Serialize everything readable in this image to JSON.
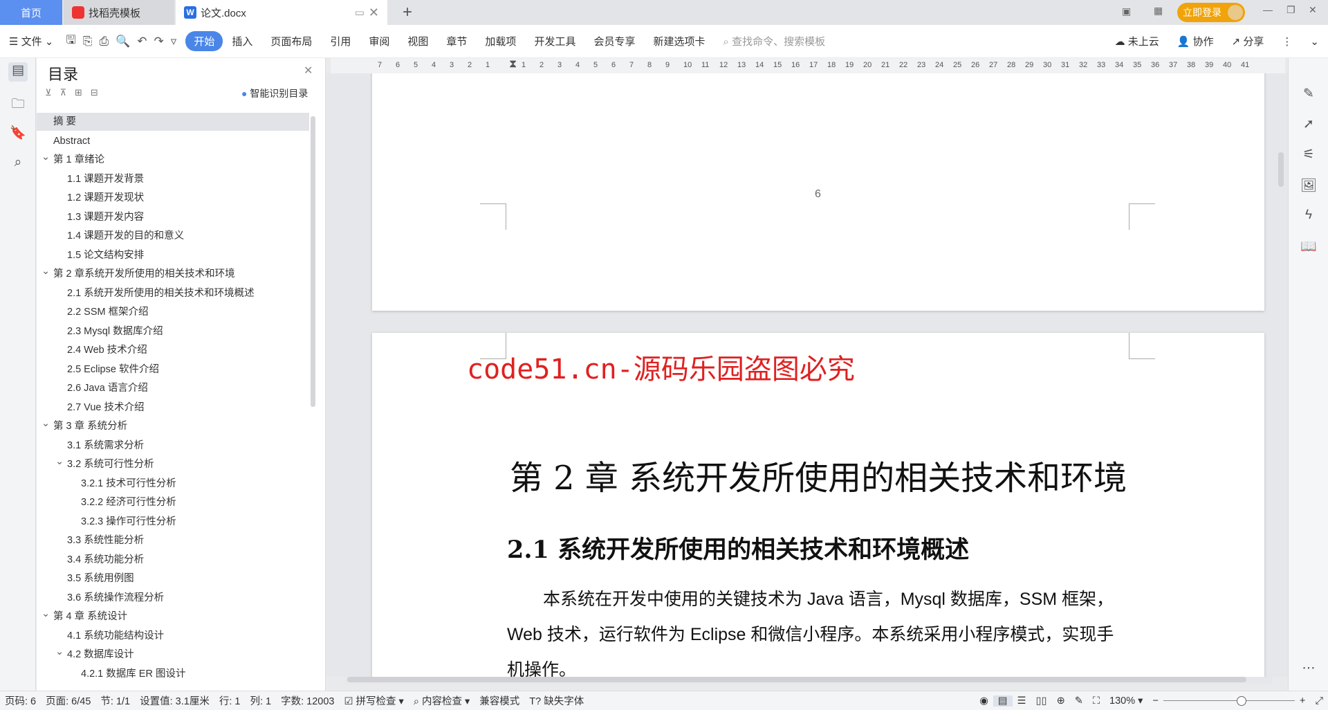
{
  "tabs": [
    {
      "label": "首页",
      "active": false
    },
    {
      "label": "找稻壳模板"
    },
    {
      "label": "论文.docx",
      "active": true
    }
  ],
  "titlebar": {
    "login": "立即登录",
    "new_tab": "+"
  },
  "toolbar": {
    "file": "文件",
    "menus": [
      "开始",
      "插入",
      "页面布局",
      "引用",
      "审阅",
      "视图",
      "章节",
      "加载项",
      "开发工具",
      "会员专享",
      "新建选项卡"
    ],
    "search_placeholder": "查找命令、搜索模板",
    "cloud": "未上云",
    "collab": "协作",
    "share": "分享"
  },
  "ruler": {
    "left": [
      "7",
      "6",
      "5",
      "4",
      "3",
      "2",
      "1"
    ],
    "right": [
      "1",
      "2",
      "3",
      "4",
      "5",
      "6",
      "7",
      "8",
      "9",
      "10",
      "11",
      "12",
      "13",
      "14",
      "15",
      "16",
      "17",
      "18",
      "19",
      "20",
      "21",
      "22",
      "23",
      "24",
      "25",
      "26",
      "27",
      "28",
      "29",
      "30",
      "31",
      "32",
      "33",
      "34",
      "35",
      "36",
      "37",
      "38",
      "39",
      "40",
      "41"
    ]
  },
  "outline": {
    "title": "目录",
    "smart": "智能识别目录",
    "items": [
      {
        "t": "摘  要",
        "l": 0,
        "sel": true
      },
      {
        "t": "Abstract",
        "l": 0
      },
      {
        "t": "第 1 章绪论",
        "l": 0,
        "c": true
      },
      {
        "t": "1.1 课题开发背景",
        "l": 1
      },
      {
        "t": "1.2 课题开发现状",
        "l": 1
      },
      {
        "t": "1.3 课题开发内容",
        "l": 1
      },
      {
        "t": "1.4 课题开发的目的和意义",
        "l": 1
      },
      {
        "t": "1.5 论文结构安排",
        "l": 1
      },
      {
        "t": "第 2 章系统开发所使用的相关技术和环境",
        "l": 0,
        "c": true
      },
      {
        "t": "2.1 系统开发所使用的相关技术和环境概述",
        "l": 1
      },
      {
        "t": "2.2 SSM 框架介绍",
        "l": 1
      },
      {
        "t": "2.3 Mysql 数据库介绍",
        "l": 1
      },
      {
        "t": "2.4 Web 技术介绍",
        "l": 1
      },
      {
        "t": "2.5 Eclipse 软件介绍",
        "l": 1
      },
      {
        "t": "2.6 Java 语言介绍",
        "l": 1
      },
      {
        "t": "2.7 Vue 技术介绍",
        "l": 1
      },
      {
        "t": "第 3 章  系统分析",
        "l": 0,
        "c": true
      },
      {
        "t": "3.1 系统需求分析",
        "l": 1
      },
      {
        "t": "3.2 系统可行性分析",
        "l": 1,
        "c": true
      },
      {
        "t": "3.2.1 技术可行性分析",
        "l": 2
      },
      {
        "t": "3.2.2 经济可行性分析",
        "l": 2
      },
      {
        "t": "3.2.3 操作可行性分析",
        "l": 2
      },
      {
        "t": "3.3 系统性能分析",
        "l": 1
      },
      {
        "t": "3.4  系统功能分析",
        "l": 1
      },
      {
        "t": "3.5 系统用例图",
        "l": 1
      },
      {
        "t": "3.6 系统操作流程分析",
        "l": 1
      },
      {
        "t": "第 4 章  系统设计",
        "l": 0,
        "c": true
      },
      {
        "t": "4.1 系统功能结构设计",
        "l": 1
      },
      {
        "t": "4.2 数据库设计",
        "l": 1,
        "c": true
      },
      {
        "t": "4.2.1 数据库 ER 图设计",
        "l": 2
      }
    ]
  },
  "document": {
    "page_number": "6",
    "watermark": "code51.cn-源码乐园盗图必究",
    "chapter": "第 2 章  系统开发所使用的相关技术和环境",
    "section": "2.1 系统开发所使用的相关技术和环境概述",
    "para": [
      "本系统在开发中使用的关键技术为 Java 语言，Mysql 数据库，SSM 框架，",
      "Web 技术，运行软件为 Eclipse 和微信小程序。本系统采用小程序模式，实现手",
      "机操作。"
    ]
  },
  "status": {
    "items": [
      "页码: 6",
      "页面: 6/45",
      "节: 1/1",
      "设置值: 3.1厘米",
      "行: 1",
      "列: 1",
      "字数: 12003"
    ],
    "spell": "拼写检查",
    "content": "内容检查",
    "compat": "兼容模式",
    "missing_font": "缺失字体",
    "zoom": "130%",
    "zoom_level": 0.6
  },
  "colors": {
    "accent": "#4a86e8",
    "login": "#f0a30a",
    "watermark": "#e02020"
  }
}
